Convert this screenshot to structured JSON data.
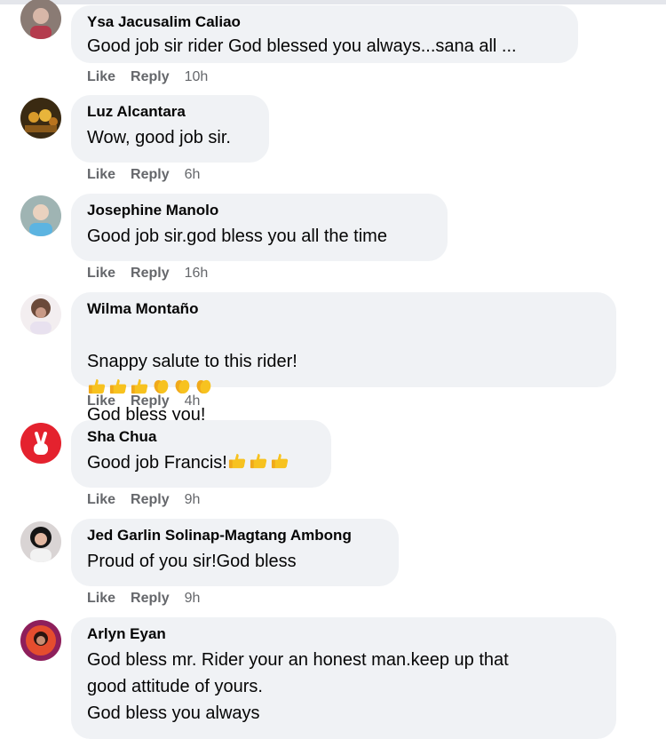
{
  "comments": [
    {
      "author": "Ysa Jacusalim Caliao",
      "text": "Good job sir rider God blessed you always...sana all ...",
      "like": "Like",
      "reply": "Reply",
      "time": "10h",
      "avatar": "person-avatar-icon"
    },
    {
      "author": "Luz Alcantara",
      "text": "Wow, good job sir.",
      "like": "Like",
      "reply": "Reply",
      "time": "6h",
      "avatar": "candles-avatar-icon"
    },
    {
      "author": "Josephine Manolo",
      "text": "Good job sir.god bless you all the time",
      "like": "Like",
      "reply": "Reply",
      "time": "16h",
      "avatar": "person-avatar-icon"
    },
    {
      "author": "Wilma Montaño",
      "text_before": "Snappy salute to this rider!",
      "text_after": "God bless you!",
      "like": "Like",
      "reply": "Reply",
      "time": "4h",
      "emojis": [
        "thumbs-up-emoji",
        "thumbs-up-emoji",
        "thumbs-up-emoji",
        "clap-emoji",
        "clap-emoji",
        "clap-emoji"
      ]
    },
    {
      "author": "Sha Chua",
      "text": "Good job Francis!",
      "like": "Like",
      "reply": "Reply",
      "time": "9h",
      "emojis": [
        "thumbs-up-emoji",
        "thumbs-up-emoji",
        "thumbs-up-emoji"
      ],
      "avatar": "peace-sign-avatar-icon"
    },
    {
      "author": "Jed Garlin Solinap-Magtang Ambong",
      "text": "Proud of you sir!God bless",
      "like": "Like",
      "reply": "Reply",
      "time": "9h",
      "avatar": "person-avatar-icon"
    },
    {
      "author": "Arlyn Eyan",
      "text": "God bless mr. Rider your an honest man.keep up that\ngood attitude of yours.\nGod bless you always",
      "avatar": "person-avatar-icon"
    }
  ],
  "colors": {
    "bubble": "#f0f2f5",
    "meta": "#65676b",
    "text": "#050505",
    "emoji": "#f7c21f"
  }
}
